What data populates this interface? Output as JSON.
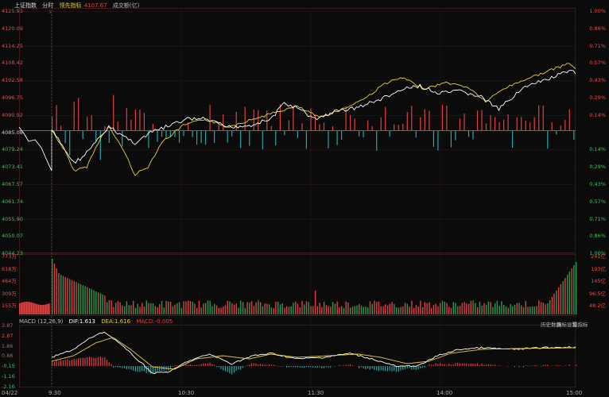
{
  "header": {
    "index_name": "上证指数",
    "mode": "分时",
    "leading_label": "领先指标",
    "leading_value": "4107.67",
    "amount_label": "成交额(亿)"
  },
  "price_axis": {
    "left": [
      "4125.93",
      "4120.09",
      "4114.25",
      "4108.42",
      "4102.58",
      "4096.75",
      "4090.92",
      "4085.08",
      "4079.24",
      "4073.41",
      "4067.57",
      "4061.74",
      "4055.90",
      "4050.07",
      "4044.23"
    ],
    "right": [
      "1.00%",
      "0.86%",
      "0.71%",
      "0.57%",
      "0.43%",
      "0.29%",
      "0.14%",
      "",
      "0.14%",
      "0.29%",
      "0.43%",
      "0.57%",
      "0.71%",
      "0.86%",
      "1.00%"
    ]
  },
  "volume_axis": {
    "left": [
      "773万",
      "618万",
      "464万",
      "309万",
      "155万"
    ],
    "right": [
      "241亿",
      "193亿",
      "145亿",
      "96.5亿",
      "48.2亿"
    ]
  },
  "macd": {
    "title": "MACD (12,26,9)",
    "dif": "DIF:1.613",
    "dea": "DEA:1.616",
    "macd": "MACD:-0.005",
    "axis": [
      "3.87",
      "2.87",
      "1.86",
      "0.86",
      "-0.15",
      "-1.16",
      "-2.16"
    ],
    "buttons": [
      "历史数据",
      "指标设置",
      "换指标"
    ]
  },
  "time_axis": [
    "04/22",
    "9:30",
    "10:30",
    "11:30",
    "14:00",
    "15:00"
  ],
  "colors": {
    "up": "#e04040",
    "down": "#2aa6a8",
    "price": "#ffffff",
    "avg": "#e8d23c",
    "axis_up": "#e05050",
    "axis_down": "#40c060",
    "grid": "#2b1515"
  }
}
